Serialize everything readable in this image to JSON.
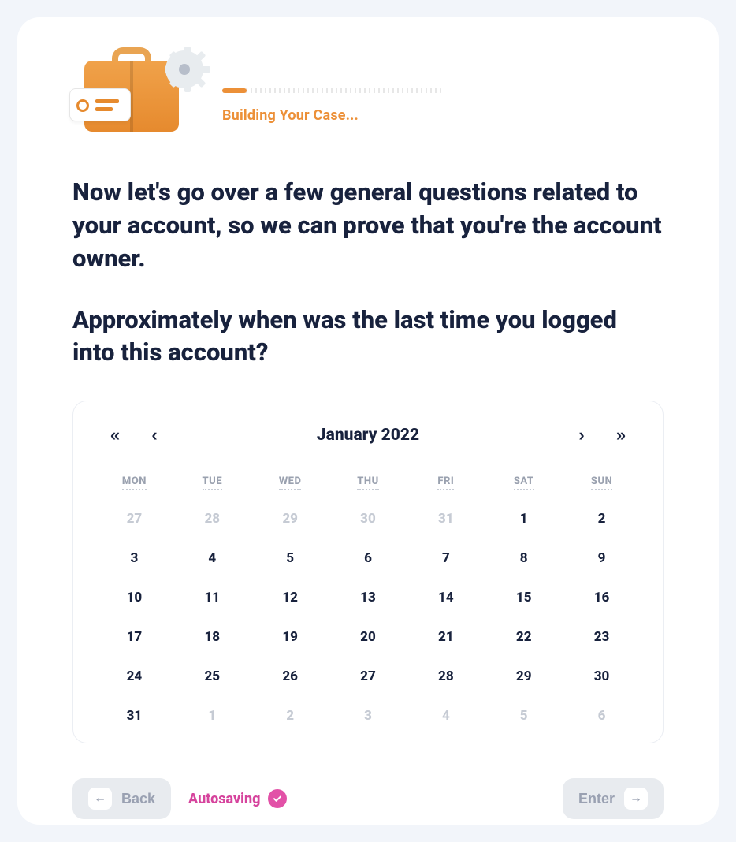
{
  "progress": {
    "label": "Building Your Case..."
  },
  "heading": {
    "intro": "Now let's go over a few general questions related to your account, so we can prove that you're the account owner.",
    "question": "Approximately when was the last time you logged into this account?"
  },
  "calendar": {
    "nav": {
      "prev_year": "«",
      "prev_month": "‹",
      "next_month": "›",
      "next_year": "»"
    },
    "title": "January 2022",
    "weekdays": [
      "MON",
      "TUE",
      "WED",
      "THU",
      "FRI",
      "SAT",
      "SUN"
    ],
    "days": [
      {
        "n": "27",
        "neighbor": true
      },
      {
        "n": "28",
        "neighbor": true
      },
      {
        "n": "29",
        "neighbor": true
      },
      {
        "n": "30",
        "neighbor": true
      },
      {
        "n": "31",
        "neighbor": true
      },
      {
        "n": "1",
        "neighbor": false
      },
      {
        "n": "2",
        "neighbor": false
      },
      {
        "n": "3",
        "neighbor": false
      },
      {
        "n": "4",
        "neighbor": false
      },
      {
        "n": "5",
        "neighbor": false
      },
      {
        "n": "6",
        "neighbor": false
      },
      {
        "n": "7",
        "neighbor": false
      },
      {
        "n": "8",
        "neighbor": false
      },
      {
        "n": "9",
        "neighbor": false
      },
      {
        "n": "10",
        "neighbor": false
      },
      {
        "n": "11",
        "neighbor": false
      },
      {
        "n": "12",
        "neighbor": false
      },
      {
        "n": "13",
        "neighbor": false
      },
      {
        "n": "14",
        "neighbor": false
      },
      {
        "n": "15",
        "neighbor": false
      },
      {
        "n": "16",
        "neighbor": false
      },
      {
        "n": "17",
        "neighbor": false
      },
      {
        "n": "18",
        "neighbor": false
      },
      {
        "n": "19",
        "neighbor": false
      },
      {
        "n": "20",
        "neighbor": false
      },
      {
        "n": "21",
        "neighbor": false
      },
      {
        "n": "22",
        "neighbor": false
      },
      {
        "n": "23",
        "neighbor": false
      },
      {
        "n": "24",
        "neighbor": false
      },
      {
        "n": "25",
        "neighbor": false
      },
      {
        "n": "26",
        "neighbor": false
      },
      {
        "n": "27",
        "neighbor": false
      },
      {
        "n": "28",
        "neighbor": false
      },
      {
        "n": "29",
        "neighbor": false
      },
      {
        "n": "30",
        "neighbor": false
      },
      {
        "n": "31",
        "neighbor": false
      },
      {
        "n": "1",
        "neighbor": true
      },
      {
        "n": "2",
        "neighbor": true
      },
      {
        "n": "3",
        "neighbor": true
      },
      {
        "n": "4",
        "neighbor": true
      },
      {
        "n": "5",
        "neighbor": true
      },
      {
        "n": "6",
        "neighbor": true
      }
    ]
  },
  "footer": {
    "back": "Back",
    "autosave": "Autosaving",
    "enter": "Enter"
  }
}
